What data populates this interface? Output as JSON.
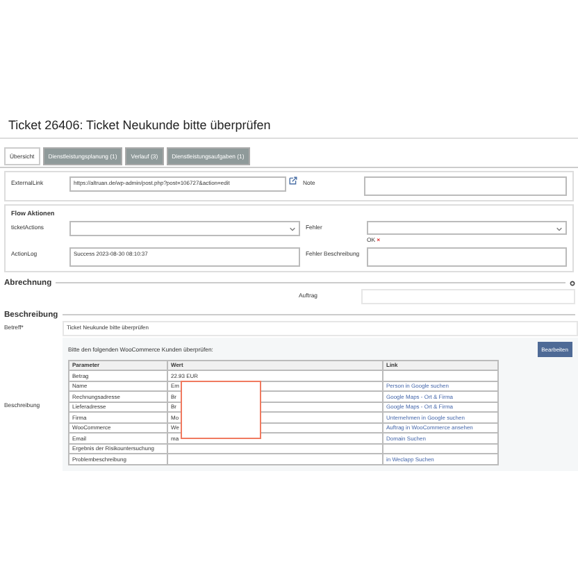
{
  "title": "Ticket 26406: Ticket Neukunde bitte überprüfen",
  "tabs": [
    {
      "label": "Übersicht",
      "selected": true
    },
    {
      "label": "Dienstleistungsplanung (1)",
      "selected": false
    },
    {
      "label": "Verlauf (3)",
      "selected": false
    },
    {
      "label": "Dienstleistungsaufgaben (1)",
      "selected": false
    }
  ],
  "external_link": {
    "label": "ExternalLink",
    "value": "https://altruan.de/wp-admin/post.php?post=106727&action=edit"
  },
  "note": {
    "label": "Note"
  },
  "flow": {
    "heading": "Flow Aktionen",
    "ticket_actions": "ticketActions",
    "fehler": "Fehler",
    "status": "OK",
    "status_mark": "×",
    "action_log_label": "ActionLog",
    "action_log": "Success 2023-08-30 08:10:37",
    "fehler_beschreibung": "Fehler Beschreibung"
  },
  "abrechnung": {
    "heading": "Abrechnung",
    "auftrag": "Auftrag"
  },
  "beschreibung": {
    "heading": "Beschreibung",
    "betreff_label": "Betreff*",
    "betreff": "Ticket Neukunde bitte überprüfen",
    "label": "Beschreibung",
    "intro": "Bitte den folgenden WooCommerce Kunden überprüfen:",
    "button": "Bearbeiten"
  },
  "table": {
    "columns": [
      "Parameter",
      "Wert",
      "Link"
    ],
    "rows": [
      [
        "Betrag",
        "22.93 EUR",
        ""
      ],
      [
        "Name",
        "Em",
        "Person in Google suchen"
      ],
      [
        "Rechnungsadresse",
        "Br",
        "Google Maps - Ort & Firma"
      ],
      [
        "Lieferadresse",
        "Br",
        "Google Maps - Ort & Firma"
      ],
      [
        "Firma",
        "Mo",
        "Unternehmen in Google suchen"
      ],
      [
        "WooCommerce",
        "We",
        "Auftrag in WooCommerce ansehen"
      ],
      [
        "Email",
        "ma",
        "Domain Suchen"
      ],
      [
        "Ergebnis der Risikountersuchung",
        "",
        ""
      ],
      [
        "Problembeschreibung",
        "",
        "in Weclapp Suchen"
      ]
    ]
  }
}
